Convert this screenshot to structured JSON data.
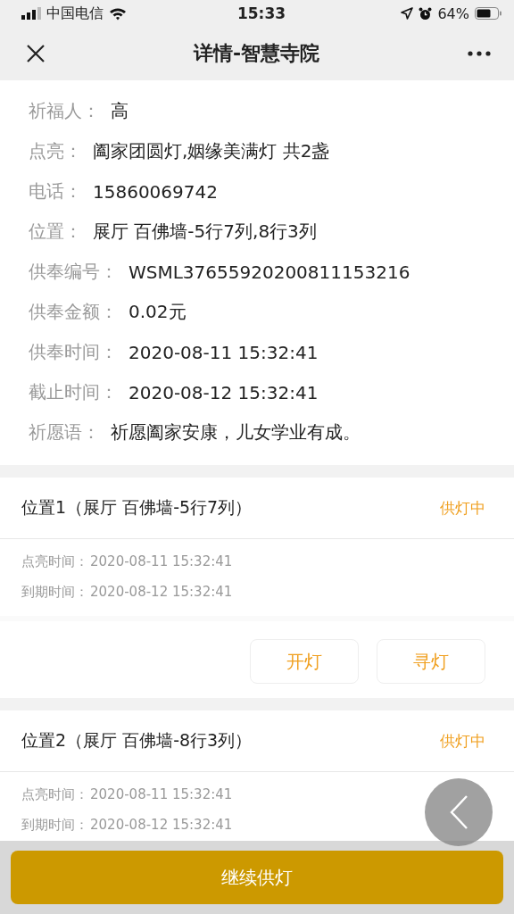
{
  "status_bar": {
    "carrier": "中国电信",
    "time": "15:33",
    "battery": "64%"
  },
  "nav": {
    "title": "详情-智慧寺院"
  },
  "details": [
    {
      "label": "祈福人：",
      "value": "高"
    },
    {
      "label": "点亮：",
      "value": "阖家团圆灯,姻缘美满灯 共2盏"
    },
    {
      "label": "电话：",
      "value": "15860069742"
    },
    {
      "label": "位置：",
      "value": "展厅 百佛墙-5行7列,8行3列"
    },
    {
      "label": "供奉编号：",
      "value": "WSML37655920200811153216"
    },
    {
      "label": "供奉金额：",
      "value": "0.02元"
    },
    {
      "label": "供奉时间：",
      "value": "2020-08-11 15:32:41"
    },
    {
      "label": "截止时间：",
      "value": "2020-08-12 15:32:41"
    },
    {
      "label": "祈愿语：",
      "value": "祈愿阖家安康，儿女学业有成。"
    }
  ],
  "positions": [
    {
      "title": "位置1（展厅 百佛墙-5行7列）",
      "status": "供灯中",
      "times": [
        {
          "label": "点亮时间：",
          "value": "2020-08-11 15:32:41"
        },
        {
          "label": "到期时间：",
          "value": "2020-08-12 15:32:41"
        }
      ],
      "buttons": [
        "开灯",
        "寻灯"
      ]
    },
    {
      "title": "位置2（展厅 百佛墙-8行3列）",
      "status": "供灯中",
      "times": [
        {
          "label": "点亮时间：",
          "value": "2020-08-11 15:32:41"
        },
        {
          "label": "到期时间：",
          "value": "2020-08-12 15:32:41"
        }
      ]
    }
  ],
  "bottom_button": "继续供灯"
}
